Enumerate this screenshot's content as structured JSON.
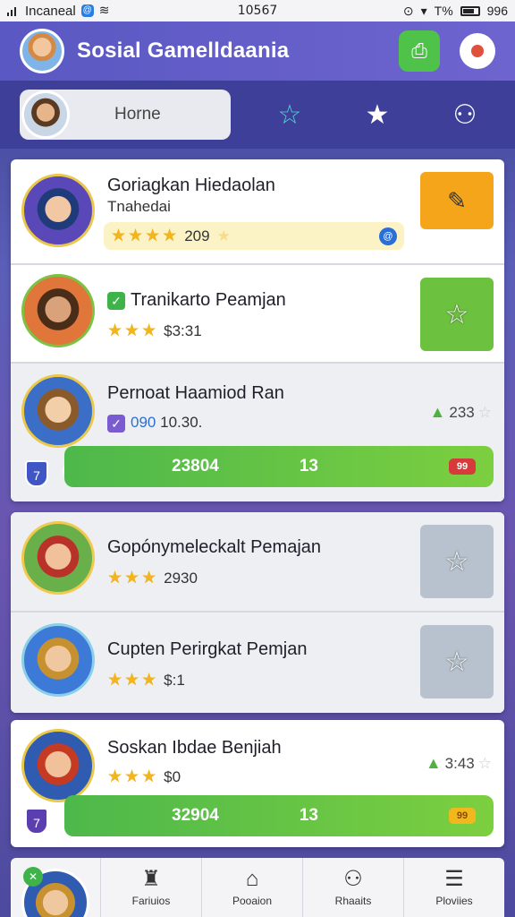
{
  "status_bar": {
    "carrier": "Incaneal",
    "time": "10567",
    "battery": "T%",
    "right_number": "996"
  },
  "header": {
    "title": "Sosial Gamelldaania"
  },
  "nav": {
    "home_label": "Horne"
  },
  "entries": [
    {
      "name": "Goriagkan Hiedaolan",
      "subtitle": "Tnahedai",
      "score": "209",
      "action": "edit",
      "action_color": "#f5a51a"
    },
    {
      "name": "Tranikarto Peamjan",
      "score": "$3:31",
      "action": "star",
      "action_color": "#6cc23e"
    },
    {
      "name": "Pernoat Haamiod Ran",
      "value": "090",
      "value_suffix": "10.30.",
      "delta": "233",
      "progress_a": "23804",
      "progress_b": "13",
      "badge": "99"
    },
    {
      "name": "Gopónymeleckalt Pemajan",
      "score": "2930",
      "action": "star",
      "action_color": "#b7c2ce"
    },
    {
      "name": "Cupten Perirgkat Pemjan",
      "score": "$:1",
      "action": "star",
      "action_color": "#b7c2ce"
    },
    {
      "name": "Soskan Ibdae Benjiah",
      "score": "$0",
      "delta": "3:43",
      "progress_a": "32904",
      "progress_b": "13",
      "badge": "99"
    }
  ],
  "bottom_nav": {
    "tabs": [
      {
        "label": "Fariuios",
        "icon": "controller-icon"
      },
      {
        "label": "Pooaion",
        "icon": "home-icon"
      },
      {
        "label": "Rhaaits",
        "icon": "people-icon"
      },
      {
        "label": "Ploviies",
        "icon": "list-icon"
      }
    ]
  },
  "colors": {
    "accent_green": "#4fc24a",
    "header_purple": "#5a58c2",
    "star_gold": "#f3b519"
  }
}
